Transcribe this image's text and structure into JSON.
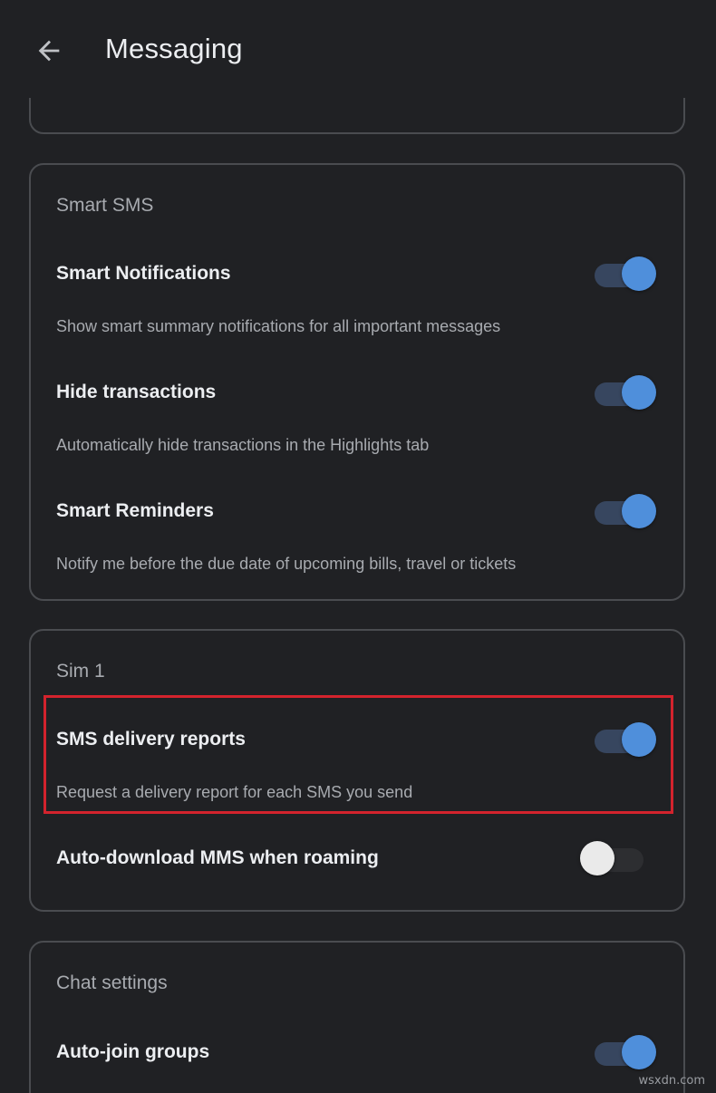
{
  "header": {
    "title": "Messaging",
    "back_icon": "arrow-left-icon"
  },
  "sections": {
    "smart_sms": {
      "title": "Smart SMS",
      "rows": [
        {
          "title": "Smart Notifications",
          "description": "Show smart summary notifications for all important messages",
          "enabled": true
        },
        {
          "title": "Hide transactions",
          "description": "Automatically hide transactions in the Highlights tab",
          "enabled": true
        },
        {
          "title": "Smart Reminders",
          "description": "Notify me before the due date of upcoming bills, travel or tickets",
          "enabled": true
        }
      ]
    },
    "sim1": {
      "title": "Sim 1",
      "rows": [
        {
          "title": "SMS delivery reports",
          "description": "Request a delivery report for each SMS you send",
          "enabled": true
        },
        {
          "title": "Auto-download MMS when roaming",
          "enabled": false
        }
      ]
    },
    "chat_settings": {
      "title": "Chat settings",
      "rows": [
        {
          "title": "Auto-join groups",
          "enabled": true
        }
      ]
    }
  },
  "colors": {
    "background": "#202124",
    "accent": "#4f8fdb",
    "highlight_border": "#d3232d"
  },
  "watermark": "wsxdn.com"
}
